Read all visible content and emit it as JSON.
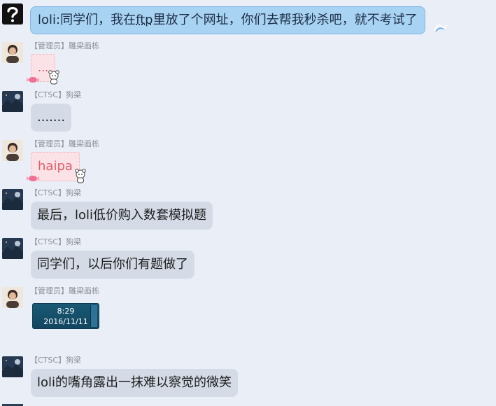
{
  "messages": [
    {
      "id": "m1",
      "sender": "",
      "text_parts": [
        "loli:同学们，我在",
        "ftp",
        "里放了个网址，你们去帮我秒杀吧，就不考试了"
      ]
    },
    {
      "id": "m2",
      "sender": "【管理员】雕梁画栋",
      "text": "..."
    },
    {
      "id": "m3",
      "sender": "【CTSC】狗梁",
      "text": "......."
    },
    {
      "id": "m4",
      "sender": "【管理员】雕梁画栋",
      "text": "haipa"
    },
    {
      "id": "m5",
      "sender": "【CTSC】狗梁",
      "text": "最后，loli低价购入数套模拟题"
    },
    {
      "id": "m6",
      "sender": "【CTSC】狗梁",
      "text": "同学们，以后你们有题做了"
    },
    {
      "id": "m7",
      "sender": "【管理员】雕梁画栋",
      "clock": {
        "time": "8:29",
        "date": "2016/11/11"
      }
    },
    {
      "id": "m8",
      "sender": "【CTSC】狗梁",
      "text": "loli的嘴角露出一抹难以察觉的微笑"
    }
  ],
  "icons": {
    "unknown_avatar": "question-mark-icon",
    "admin_avatar": "admin-avatar",
    "ctsc_avatar": "ctsc-avatar"
  },
  "colors": {
    "background": "#eaeef7",
    "bubble_gray": "#d4dbe6",
    "bubble_blue": "#a9d3f3",
    "bubble_pink": "#fbe2e6",
    "pink_text": "#e25d66"
  }
}
